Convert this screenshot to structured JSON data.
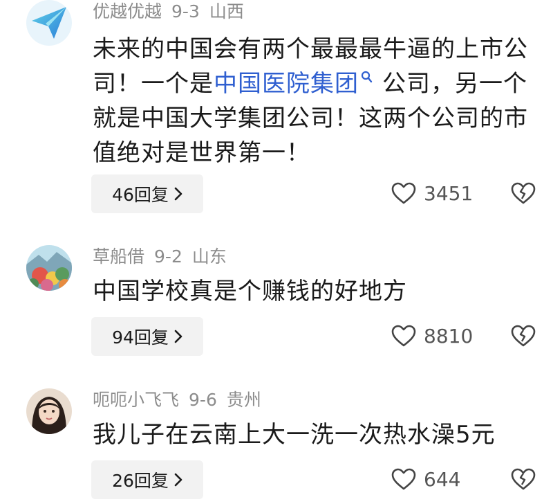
{
  "comments": [
    {
      "user": "优越优越",
      "date": "9-3",
      "location": "山西",
      "text_before": "未来的中国会有两个最最最牛逼的上市公司！一个是",
      "link_text": "中国医院集团",
      "text_after": "公司，另一个就是中国大学集团公司！这两个公司的市值绝对是世界第一！",
      "reply_label": "46回复",
      "likes": "3451",
      "avatar_icon": "paper-plane-icon"
    },
    {
      "user": "草船借",
      "date": "9-2",
      "location": "山东",
      "text": "中国学校真是个赚钱的好地方",
      "reply_label": "94回复",
      "likes": "8810",
      "avatar_icon": "landscape-painting-icon"
    },
    {
      "user": "呃呃小飞飞",
      "date": "9-6",
      "location": "贵州",
      "text": "我儿子在云南上大一洗一次热水澡5元",
      "reply_label": "26回复",
      "likes": "644",
      "avatar_icon": "portrait-icon"
    }
  ],
  "colors": {
    "link": "#2f5fd0",
    "meta": "#8c8c8c",
    "reply_bg": "#f2f2f2"
  }
}
